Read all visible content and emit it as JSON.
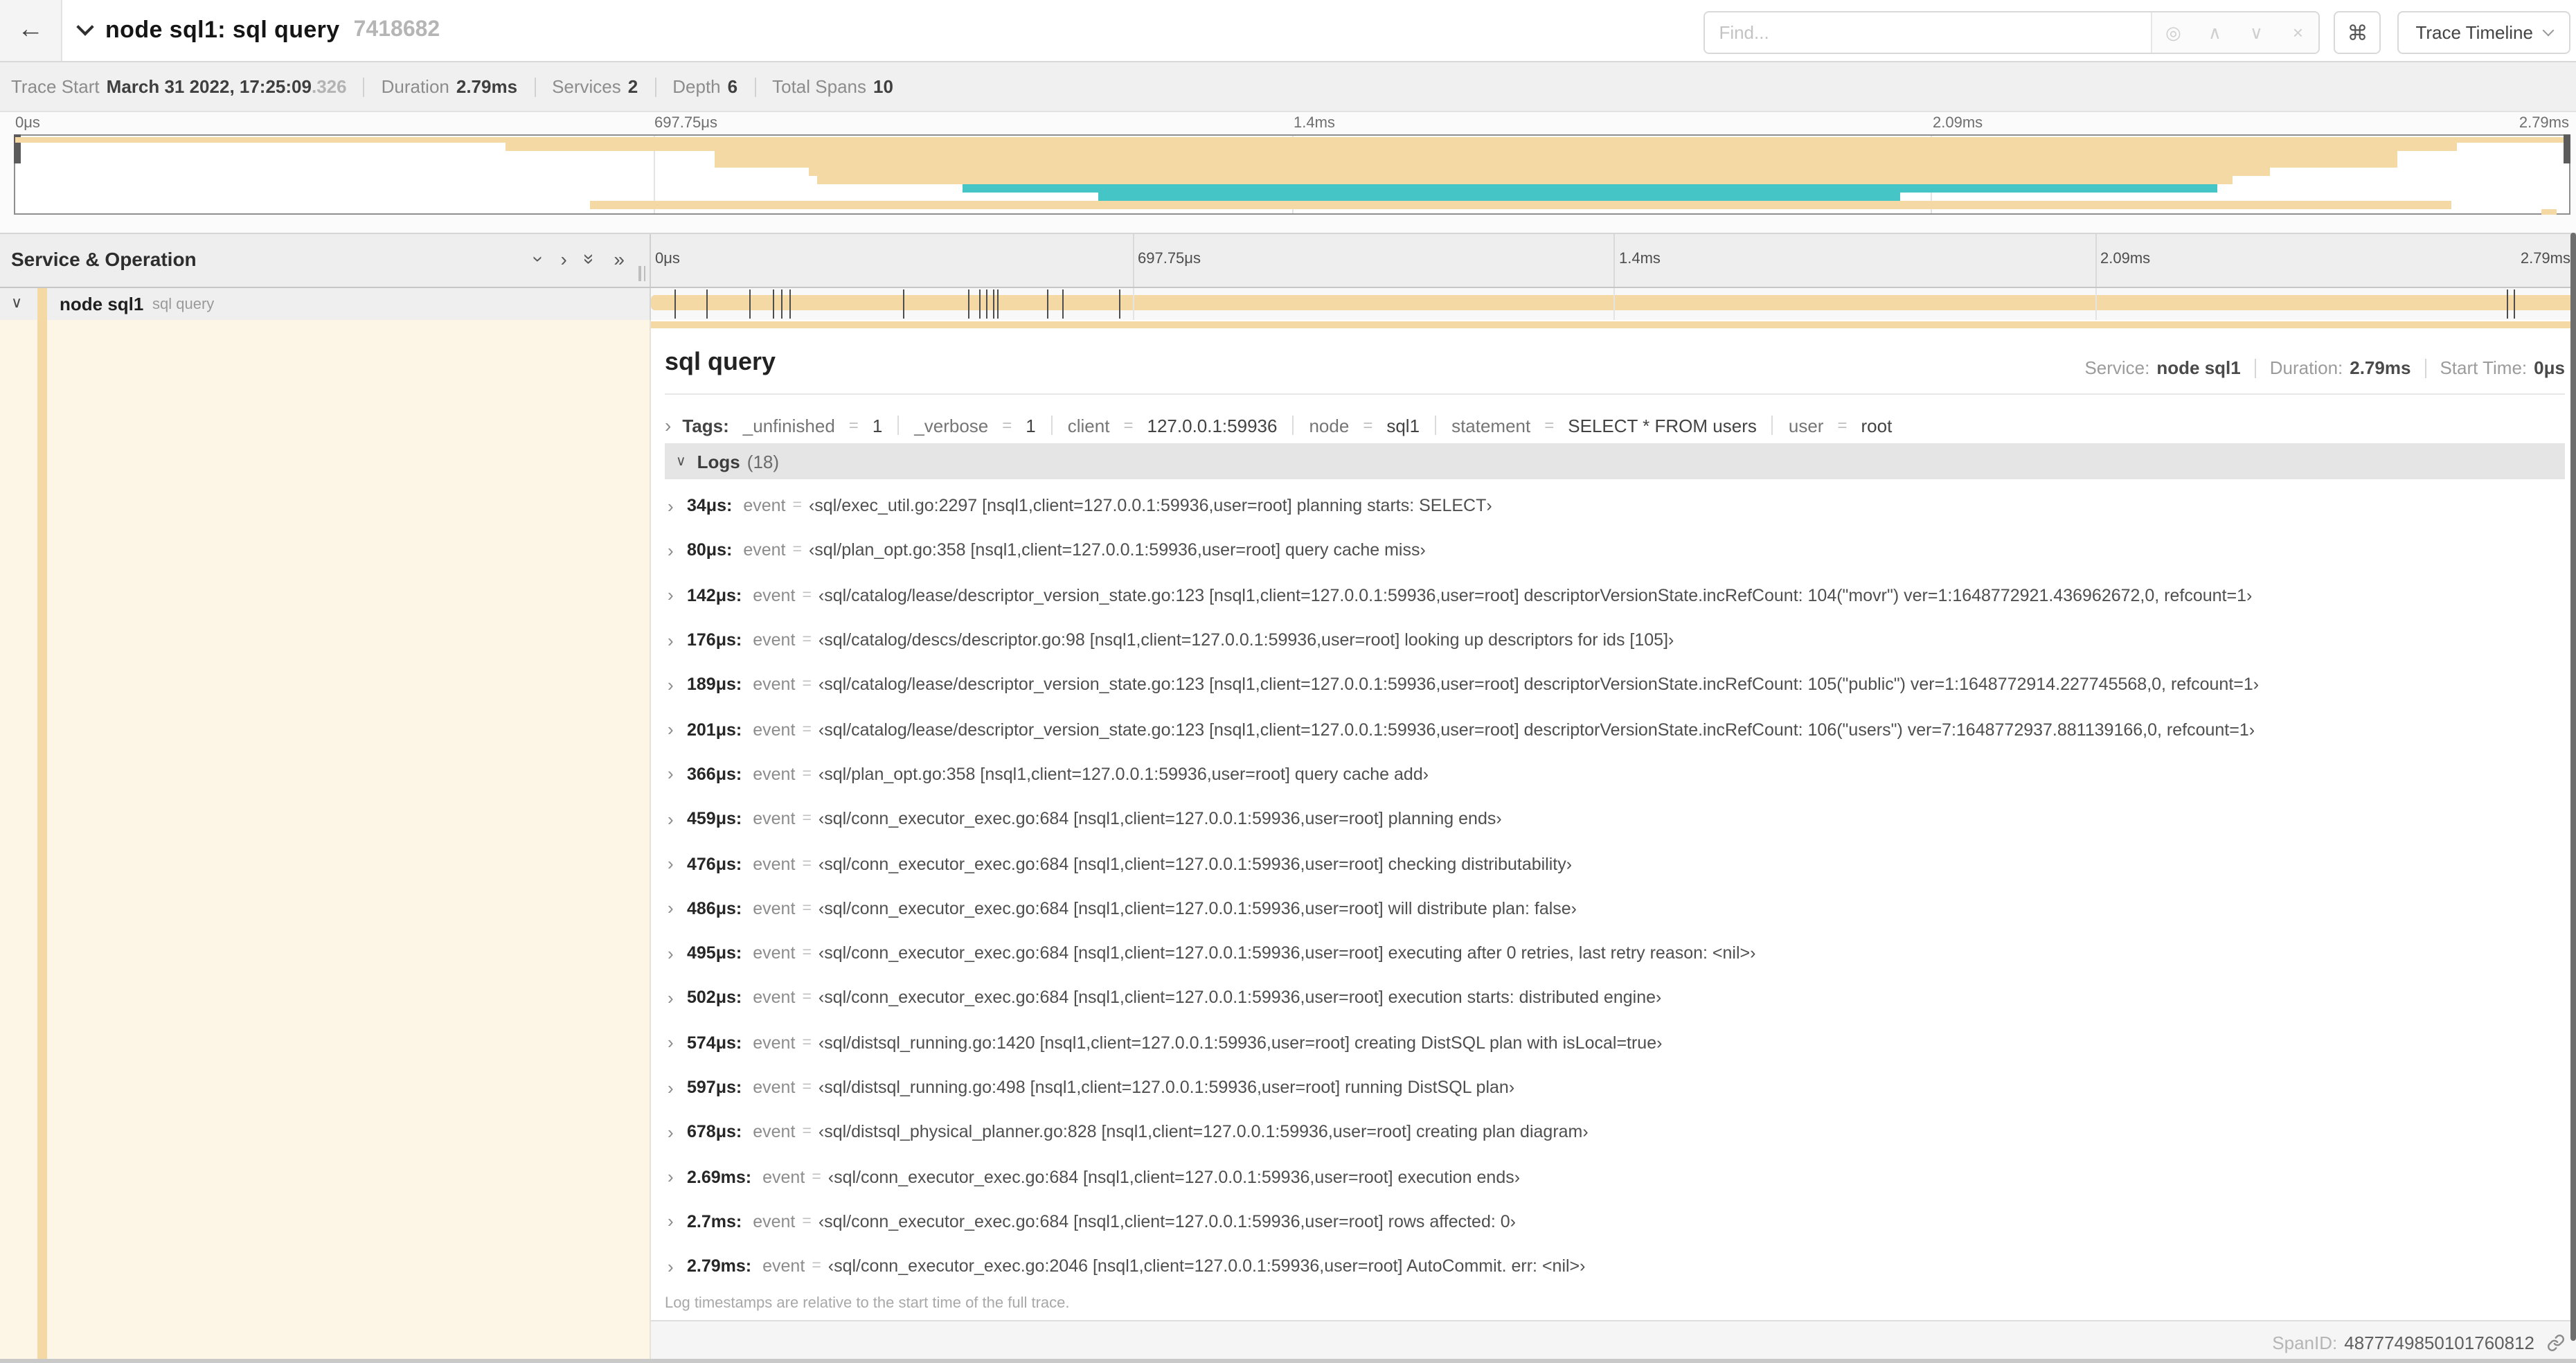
{
  "colors": {
    "span_tan": "#F4D9A4",
    "span_teal": "#45C5C5"
  },
  "header": {
    "back_icon": "←",
    "title": "node sql1: sql query",
    "trace_id": "7418682",
    "find_placeholder": "Find...",
    "shortcut_button": "⌘",
    "view_selector": "Trace Timeline"
  },
  "trace_info": {
    "items": [
      {
        "label": "Trace Start",
        "value": "March 31 2022, 17:25:09",
        "suffix": ".326"
      },
      {
        "label": "Duration",
        "value": "2.79ms"
      },
      {
        "label": "Services",
        "value": "2"
      },
      {
        "label": "Depth",
        "value": "6"
      },
      {
        "label": "Total Spans",
        "value": "10"
      }
    ]
  },
  "timeline": {
    "left_header": "Service & Operation",
    "time_ticks": [
      {
        "label": "0μs",
        "pct": 0
      },
      {
        "label": "697.75μs",
        "pct": 25
      },
      {
        "label": "1.4ms",
        "pct": 50
      },
      {
        "label": "2.09ms",
        "pct": 75
      },
      {
        "label": "2.79ms",
        "pct": 100
      }
    ],
    "row": {
      "service": "node sql1",
      "operation": "sql query"
    },
    "log_tick_pcts": [
      1.22,
      2.87,
      5.09,
      6.31,
      6.77,
      7.2,
      13.12,
      16.45,
      17.06,
      17.42,
      17.74,
      17.99,
      20.57,
      21.4,
      24.3,
      96.42,
      96.77,
      99.85
    ]
  },
  "minimap": {
    "spans": [
      {
        "l": 0,
        "w": 99.8,
        "t": 1,
        "h": 4,
        "c": "span_tan"
      },
      {
        "l": 19.2,
        "w": 76.4,
        "t": 5,
        "h": 6,
        "c": "span_tan"
      },
      {
        "l": 27.4,
        "w": 65.9,
        "t": 11,
        "h": 12,
        "c": "span_tan"
      },
      {
        "l": 31.1,
        "w": 57.2,
        "t": 23,
        "h": 6,
        "c": "span_tan"
      },
      {
        "l": 31.4,
        "w": 55.4,
        "t": 29,
        "h": 5.5,
        "c": "span_tan"
      },
      {
        "l": 37.1,
        "w": 49.1,
        "t": 34.5,
        "h": 6.5,
        "c": "span_teal"
      },
      {
        "l": 42.4,
        "w": 31.4,
        "t": 41,
        "h": 6,
        "c": "span_teal"
      },
      {
        "l": 22.5,
        "w": 72.9,
        "t": 47,
        "h": 6,
        "c": "span_tan"
      },
      {
        "l": 98.9,
        "w": 0.6,
        "t": 53,
        "h": 4,
        "c": "span_tan"
      }
    ]
  },
  "detail": {
    "operation": "sql query",
    "meta": [
      {
        "label": "Service:",
        "value": "node sql1"
      },
      {
        "label": "Duration:",
        "value": "2.79ms"
      },
      {
        "label": "Start Time:",
        "value": "0μs"
      }
    ],
    "tags_label": "Tags:",
    "tags": [
      {
        "key": "_unfinished",
        "value": "1"
      },
      {
        "key": "_verbose",
        "value": "1"
      },
      {
        "key": "client",
        "value": "127.0.0.1:59936"
      },
      {
        "key": "node",
        "value": "sql1"
      },
      {
        "key": "statement",
        "value": "SELECT * FROM users"
      },
      {
        "key": "user",
        "value": "root"
      }
    ],
    "logs_label": "Logs",
    "logs_count": "(18)",
    "logs": [
      {
        "time": "34μs:",
        "field": "event",
        "value": "‹sql/exec_util.go:2297 [nsql1,client=127.0.0.1:59936,user=root] planning starts: SELECT›"
      },
      {
        "time": "80μs:",
        "field": "event",
        "value": "‹sql/plan_opt.go:358 [nsql1,client=127.0.0.1:59936,user=root] query cache miss›"
      },
      {
        "time": "142μs:",
        "field": "event",
        "value": "‹sql/catalog/lease/descriptor_version_state.go:123 [nsql1,client=127.0.0.1:59936,user=root] descriptorVersionState.incRefCount: 104(\"movr\") ver=1:1648772921.436962672,0, refcount=1›"
      },
      {
        "time": "176μs:",
        "field": "event",
        "value": "‹sql/catalog/descs/descriptor.go:98 [nsql1,client=127.0.0.1:59936,user=root] looking up descriptors for ids [105]›"
      },
      {
        "time": "189μs:",
        "field": "event",
        "value": "‹sql/catalog/lease/descriptor_version_state.go:123 [nsql1,client=127.0.0.1:59936,user=root] descriptorVersionState.incRefCount: 105(\"public\") ver=1:1648772914.227745568,0, refcount=1›"
      },
      {
        "time": "201μs:",
        "field": "event",
        "value": "‹sql/catalog/lease/descriptor_version_state.go:123 [nsql1,client=127.0.0.1:59936,user=root] descriptorVersionState.incRefCount: 106(\"users\") ver=7:1648772937.881139166,0, refcount=1›"
      },
      {
        "time": "366μs:",
        "field": "event",
        "value": "‹sql/plan_opt.go:358 [nsql1,client=127.0.0.1:59936,user=root] query cache add›"
      },
      {
        "time": "459μs:",
        "field": "event",
        "value": "‹sql/conn_executor_exec.go:684 [nsql1,client=127.0.0.1:59936,user=root] planning ends›"
      },
      {
        "time": "476μs:",
        "field": "event",
        "value": "‹sql/conn_executor_exec.go:684 [nsql1,client=127.0.0.1:59936,user=root] checking distributability›"
      },
      {
        "time": "486μs:",
        "field": "event",
        "value": "‹sql/conn_executor_exec.go:684 [nsql1,client=127.0.0.1:59936,user=root] will distribute plan: false›"
      },
      {
        "time": "495μs:",
        "field": "event",
        "value": "‹sql/conn_executor_exec.go:684 [nsql1,client=127.0.0.1:59936,user=root] executing after 0 retries, last retry reason: <nil>›"
      },
      {
        "time": "502μs:",
        "field": "event",
        "value": "‹sql/conn_executor_exec.go:684 [nsql1,client=127.0.0.1:59936,user=root] execution starts: distributed engine›"
      },
      {
        "time": "574μs:",
        "field": "event",
        "value": "‹sql/distsql_running.go:1420 [nsql1,client=127.0.0.1:59936,user=root] creating DistSQL plan with isLocal=true›"
      },
      {
        "time": "597μs:",
        "field": "event",
        "value": "‹sql/distsql_running.go:498 [nsql1,client=127.0.0.1:59936,user=root] running DistSQL plan›"
      },
      {
        "time": "678μs:",
        "field": "event",
        "value": "‹sql/distsql_physical_planner.go:828 [nsql1,client=127.0.0.1:59936,user=root] creating plan diagram›"
      },
      {
        "time": "2.69ms:",
        "field": "event",
        "value": "‹sql/conn_executor_exec.go:684 [nsql1,client=127.0.0.1:59936,user=root] execution ends›"
      },
      {
        "time": "2.7ms:",
        "field": "event",
        "value": "‹sql/conn_executor_exec.go:684 [nsql1,client=127.0.0.1:59936,user=root] rows affected: 0›"
      },
      {
        "time": "2.79ms:",
        "field": "event",
        "value": "‹sql/conn_executor_exec.go:2046 [nsql1,client=127.0.0.1:59936,user=root] AutoCommit. err: <nil>›"
      }
    ],
    "logs_note": "Log timestamps are relative to the start time of the full trace.",
    "footer": {
      "label": "SpanID:",
      "value": "4877749850101760812"
    }
  }
}
